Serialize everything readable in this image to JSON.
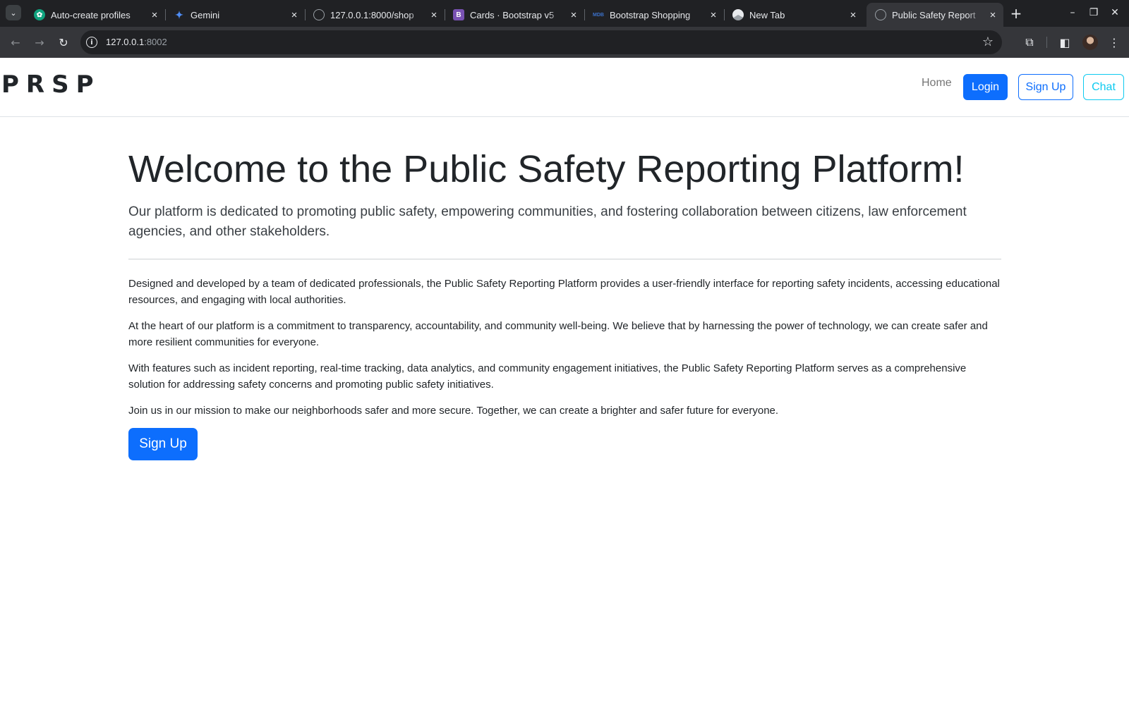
{
  "browser": {
    "tabs": [
      {
        "title": "Auto-create profiles",
        "favicon": "chatgpt-icon",
        "color": "#10a37f",
        "active": false
      },
      {
        "title": "Gemini",
        "favicon": "gemini-sparkle-icon",
        "color": "#4f8df5",
        "active": false
      },
      {
        "title": "127.0.0.1:8000/shop",
        "favicon": "globe-icon",
        "color": "#9aa0a6",
        "active": false
      },
      {
        "title": "Cards · Bootstrap v5",
        "favicon": "bootstrap-icon",
        "color": "#7952b3",
        "active": false
      },
      {
        "title": "Bootstrap Shopping",
        "favicon": "mdb-icon",
        "color": "#3b71ca",
        "active": false
      },
      {
        "title": "New Tab",
        "favicon": "chrome-icon",
        "color": "#e8eaed",
        "active": false
      },
      {
        "title": "Public Safety Report",
        "favicon": "globe-icon",
        "color": "#9aa0a6",
        "active": true
      }
    ],
    "url_host": "127.0.0.1",
    "url_port": ":8002"
  },
  "site": {
    "brand": "PRSP",
    "nav": {
      "home": "Home",
      "login": "Login",
      "signup": "Sign Up",
      "chat": "Chat"
    }
  },
  "hero": {
    "title": "Welcome to the Public Safety Reporting Platform!",
    "lead": "Our platform is dedicated to promoting public safety, empowering communities, and fostering collaboration between citizens, law enforcement agencies, and other stakeholders.",
    "paragraphs": [
      "Designed and developed by a team of dedicated professionals, the Public Safety Reporting Platform provides a user-friendly interface for reporting safety incidents, accessing educational resources, and engaging with local authorities.",
      "At the heart of our platform is a commitment to transparency, accountability, and community well-being. We believe that by harnessing the power of technology, we can create safer and more resilient communities for everyone.",
      "With features such as incident reporting, real-time tracking, data analytics, and community engagement initiatives, the Public Safety Reporting Platform serves as a comprehensive solution for addressing safety concerns and promoting public safety initiatives.",
      "Join us in our mission to make our neighborhoods safer and more secure. Together, we can create a brighter and safer future for everyone."
    ],
    "cta": "Sign Up"
  },
  "colors": {
    "primary": "#0d6efd",
    "info": "#0dcaf0",
    "text": "#212529",
    "chrome_dark": "#202124",
    "chrome_toolbar": "#35363a"
  }
}
